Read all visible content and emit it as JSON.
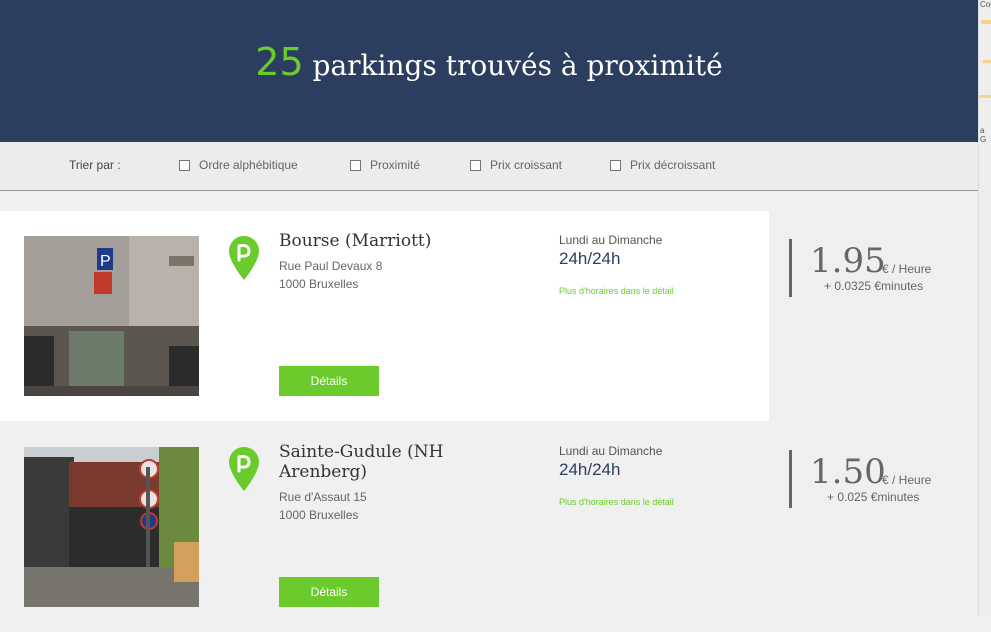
{
  "header": {
    "count": "25",
    "title_rest": "parkings trouvés à proximité"
  },
  "sort": {
    "label": "Trier par :",
    "options": [
      "Ordre alphébitique",
      "Proximité",
      "Prix croissant",
      "Prix décroissant"
    ]
  },
  "map_strip": {
    "labels": [
      "Cor",
      "a G"
    ]
  },
  "parkings": [
    {
      "name": "Bourse (Marriott)",
      "street": "Rue Paul Devaux 8",
      "city": "1000 Bruxelles",
      "days": "Lundi au Dimanche",
      "hours": "24h/24h",
      "more_hours": "Plus d'horaires dans le détail",
      "price": "1.95",
      "unit": "€ / Heure",
      "extra": "+ 0.0325 €minutes",
      "details_label": "Détails"
    },
    {
      "name": "Sainte-Gudule (NH Arenberg)",
      "street": "Rue d'Assaut 15",
      "city": "1000 Bruxelles",
      "days": "Lundi au Dimanche",
      "hours": "24h/24h",
      "more_hours": "Plus d'horaires dans le détail",
      "price": "1.50",
      "unit": "€ / Heure",
      "extra": "+ 0.025 €minutes",
      "details_label": "Détails"
    }
  ],
  "colors": {
    "header_bg": "#2c3e5f",
    "accent_green": "#6ccb2c"
  },
  "icons": {
    "pin": "parking-pin-icon",
    "checkbox": "checkbox-icon"
  }
}
